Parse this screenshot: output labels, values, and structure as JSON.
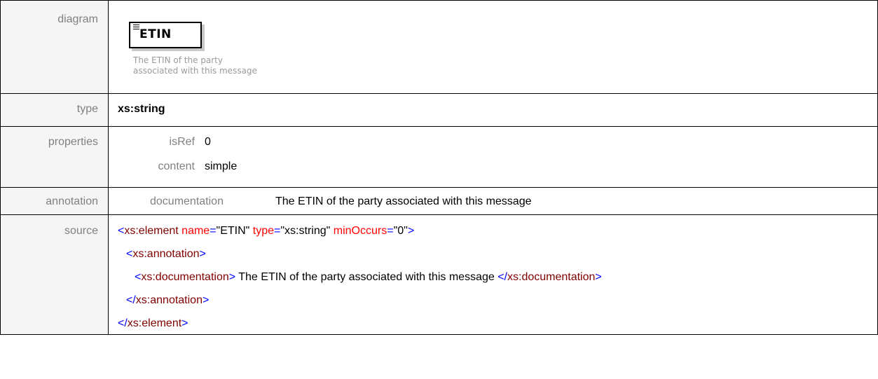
{
  "labels": {
    "diagram": "diagram",
    "type": "type",
    "properties": "properties",
    "annotation": "annotation",
    "source": "source"
  },
  "diagram": {
    "element_name": "ETIN",
    "doc_line1": "The ETIN of the party",
    "doc_line2": "associated with this message",
    "icon": "element-content-icon"
  },
  "type": {
    "value": "xs:string"
  },
  "properties": {
    "isRef_label": "isRef",
    "isRef_value": "0",
    "content_label": "content",
    "content_value": "simple"
  },
  "annotation": {
    "doc_label": "documentation",
    "doc_value": "The ETIN of the party associated with this message"
  },
  "source": {
    "line1": {
      "open": "<",
      "tag": "xs:element",
      "attr1": " name",
      "eq1": "=",
      "val1": "\"ETIN\"",
      "attr2": " type",
      "eq2": "=",
      "val2": "\"xs:string\"",
      "attr3": " minOccurs",
      "eq3": "=",
      "val3": "\"0\"",
      "close": ">"
    },
    "line2": {
      "open": "<",
      "tag": "xs:annotation",
      "close": ">"
    },
    "line3": {
      "open": "<",
      "tag": "xs:documentation",
      "close": ">",
      "text": " The ETIN of the party associated with this message ",
      "end_open": "</",
      "end_tag": "xs:documentation",
      "end_close": ">"
    },
    "line4": {
      "open": "</",
      "tag": "xs:annotation",
      "close": ">"
    },
    "line5": {
      "open": "</",
      "tag": "xs:element",
      "close": ">"
    }
  },
  "colors": {
    "tag_bracket": "#0000ff",
    "tag_name": "#800000",
    "attr_name": "#ff0000",
    "label_gray": "#808080",
    "label_bg": "#f5f5f5"
  }
}
